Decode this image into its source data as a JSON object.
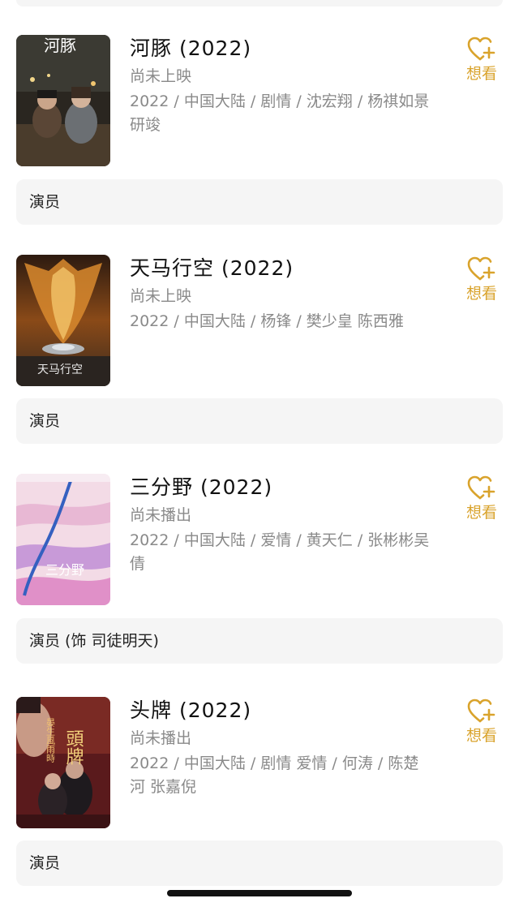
{
  "want_label": "想看",
  "movies": [
    {
      "title": "河豚",
      "year": "(2022)",
      "status": "尚未上映",
      "meta": "2022 / 中国大陆 / 剧情 / 沈宏翔 / 杨祺如景研竣",
      "poster_text": "河豚",
      "role": "演员"
    },
    {
      "title": "天马行空",
      "year": "(2022)",
      "status": "尚未上映",
      "meta": "2022 / 中国大陆 / 杨锋 / 樊少皇 陈西雅",
      "poster_text": "天马行空",
      "role": "演员"
    },
    {
      "title": "三分野",
      "year": "(2022)",
      "status": "尚未播出",
      "meta": "2022 / 中国大陆 / 爱情 / 黄天仁 / 张彬彬吴倩",
      "poster_text": "三分野",
      "role": "演员 (饰 司徒明天)"
    },
    {
      "title": "头牌",
      "year": "(2022)",
      "status": "尚未播出",
      "meta": "2022 / 中国大陆 / 剧情 爱情 / 何涛 / 陈楚河 张嘉倪",
      "poster_text": "頭牌",
      "poster_subtext": "晏生風雨時",
      "role": "演员"
    }
  ],
  "colors": {
    "accent": "#d9a32c",
    "muted_text": "#8a8a8a",
    "role_bg": "#f5f5f5"
  }
}
